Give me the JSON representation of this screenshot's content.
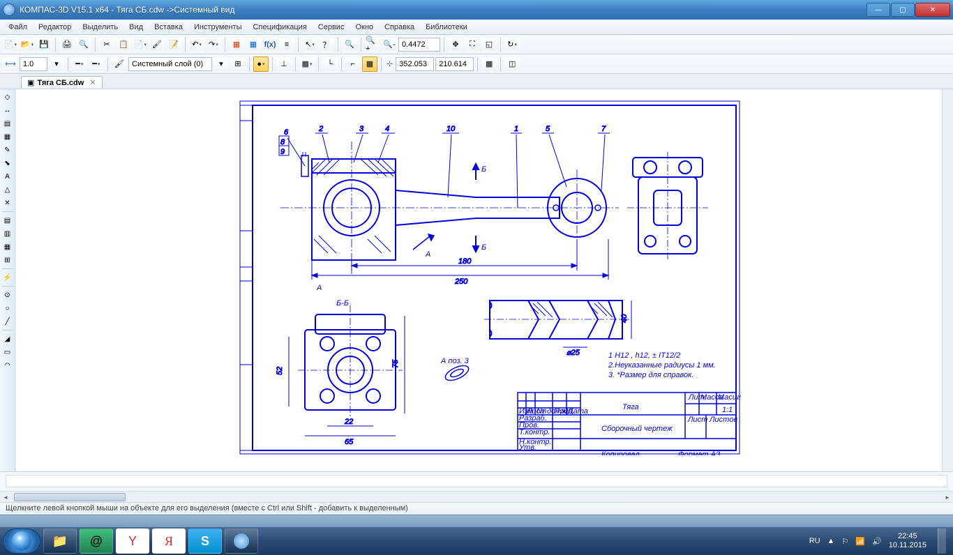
{
  "window": {
    "title": "КОМПАС-3D V15.1 x64 - Тяга СБ.cdw ->Системный вид",
    "min": "—",
    "max": "▢",
    "close": "✕"
  },
  "menu": [
    "Файл",
    "Редактор",
    "Выделить",
    "Вид",
    "Вставка",
    "Инструменты",
    "Спецификация",
    "Сервис",
    "Окно",
    "Справка",
    "Библиотеки"
  ],
  "toolbar1": {
    "fx": "f(x)",
    "zoom": "0.4472"
  },
  "toolbar2": {
    "linewidth": "1.0",
    "layer": "Системный слой (0)",
    "x": "352.053",
    "y": "210.614"
  },
  "doc": {
    "tab": "Тяга СБ.cdw",
    "close": "✕"
  },
  "drawing": {
    "callouts": [
      "6",
      "8",
      "9",
      "2",
      "3",
      "4",
      "10",
      "1",
      "5",
      "7"
    ],
    "dim180": "180",
    "dim250": "250",
    "sectBB": "Б-Б",
    "sectA": "А",
    "sectB1": "Б",
    "sectB2": "Б",
    "dim22": "22",
    "dim65": "65",
    "dim52": "52",
    "dim75": "75",
    "detA": "А поз. 3",
    "dimd25": "⌀25",
    "dim40": "40",
    "notes1": "1 H12 , h12, ± IT12/2",
    "notes2": "2.Неуказанные радиусы 1 мм.",
    "notes3": "3. *Размер для справок.",
    "tb_title": "Тяга",
    "tb_sub": "Сборочный чертеж",
    "tb_scale": "1:1",
    "tb_format": "Формат    А3",
    "tb_copy": "Копировал",
    "tb_izm": "Изм",
    "tb_list": "Лист",
    "tb_ndoc": "№ докум.",
    "tb_podp": "Подп.",
    "tb_data": "Дата",
    "tb_razrab": "Разраб.",
    "tb_prov": "Пров.",
    "tb_tkontr": "Т.контр.",
    "tb_nkontr": "Н.контр.",
    "tb_utv": "Утв.",
    "tb_lit": "Лит.",
    "tb_massa": "Масса",
    "tb_mash": "Масштаб",
    "tb_list2": "Лист",
    "tb_listov": "Листов"
  },
  "status": {
    "hint": "Щелкните левой кнопкой мыши на объекте для его выделения (вместе с Ctrl или Shift - добавить к выделенным)"
  },
  "tray": {
    "lang": "RU",
    "time": "22:45",
    "date": "10.11.2015"
  }
}
